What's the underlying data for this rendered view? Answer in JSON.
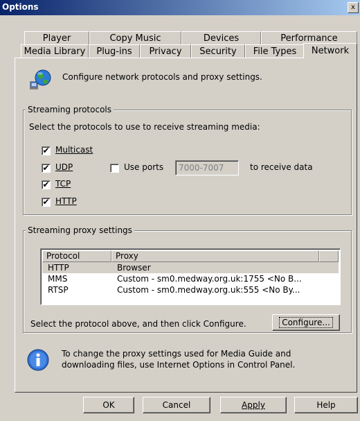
{
  "window": {
    "title": "Options",
    "close_glyph": "x"
  },
  "tabs_row1": [
    "Player",
    "Copy Music",
    "Devices",
    "Performance"
  ],
  "tabs_row2": [
    "Media Library",
    "Plug-ins",
    "Privacy",
    "Security",
    "File Types",
    "Network"
  ],
  "active_tab": "Network",
  "header_text": "Configure network protocols and proxy settings.",
  "streaming_protocols": {
    "legend": "Streaming protocols",
    "instruction": "Select the protocols to use to receive streaming media:",
    "multicast": {
      "label": "Multicast",
      "checked": true
    },
    "udp": {
      "label": "UDP",
      "checked": true
    },
    "tcp": {
      "label": "TCP",
      "checked": true
    },
    "http": {
      "label": "HTTP",
      "checked": true
    },
    "use_ports": {
      "label": "Use ports",
      "checked": false
    },
    "ports_value": "7000-7007",
    "ports_suffix": "to receive data"
  },
  "proxy_settings": {
    "legend": "Streaming proxy settings",
    "columns": [
      "Protocol",
      "Proxy"
    ],
    "rows": [
      {
        "protocol": "HTTP",
        "proxy": "Browser",
        "selected": true
      },
      {
        "protocol": "MMS",
        "proxy": "Custom - sm0.medway.org.uk:1755 <No B...",
        "selected": false
      },
      {
        "protocol": "RTSP",
        "proxy": "Custom - sm0.medway.org.uk:555 <No By...",
        "selected": false
      }
    ],
    "instruction": "Select the protocol above, and then click Configure.",
    "configure_label": "Configure..."
  },
  "info_text": "To change the proxy settings used for Media Guide and downloading files, use Internet Options in Control Panel.",
  "buttons": {
    "ok": "OK",
    "cancel": "Cancel",
    "apply": "Apply",
    "help": "Help"
  },
  "check_glyph": "✔"
}
